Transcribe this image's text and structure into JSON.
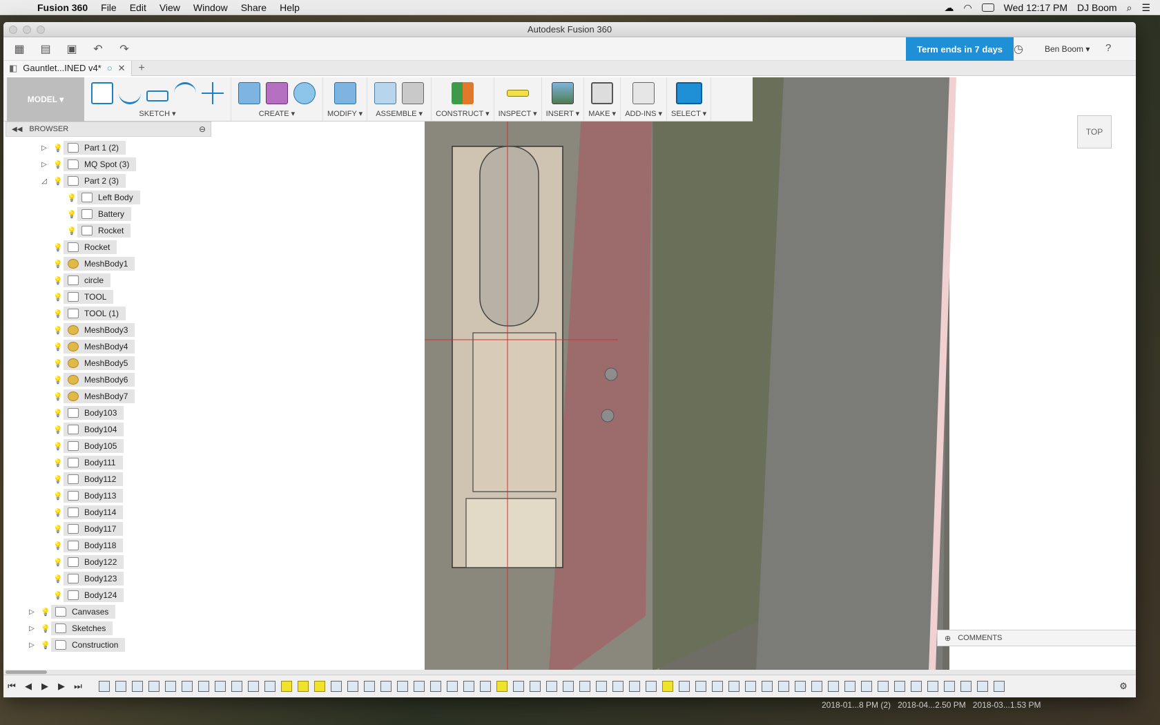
{
  "menubar": {
    "app": "Fusion 360",
    "items": [
      "File",
      "Edit",
      "View",
      "Window",
      "Share",
      "Help"
    ],
    "clock": "Wed 12:17 PM",
    "user": "DJ Boom"
  },
  "window": {
    "title": "Autodesk Fusion 360",
    "term": "Term ends in 7 days",
    "account": "Ben Boom ▾",
    "tab_title": "Gauntlet...INED v4*"
  },
  "ribbon": {
    "workspace": "MODEL ▾",
    "groups": [
      "SKETCH ▾",
      "CREATE ▾",
      "MODIFY ▾",
      "ASSEMBLE ▾",
      "CONSTRUCT ▾",
      "INSPECT ▾",
      "INSERT ▾",
      "MAKE ▾",
      "ADD-INS ▾",
      "SELECT ▾"
    ]
  },
  "browser": {
    "title": "BROWSER",
    "items": [
      {
        "label": "Part 1 (2)",
        "bulb": "on",
        "icon": "folder",
        "expand": "▷"
      },
      {
        "label": "MQ Spot (3)",
        "bulb": "on",
        "icon": "folder",
        "expand": "▷"
      },
      {
        "label": "Part 2 (3)",
        "bulb": "on",
        "icon": "folder",
        "expand": "◿"
      },
      {
        "label": "Left Body",
        "bulb": "on",
        "icon": "body",
        "expand": ""
      },
      {
        "label": "Battery",
        "bulb": "off",
        "icon": "body",
        "expand": ""
      },
      {
        "label": "Rocket",
        "bulb": "on",
        "icon": "body",
        "expand": ""
      },
      {
        "label": "Rocket",
        "bulb": "off",
        "icon": "folder",
        "expand": ""
      },
      {
        "label": "MeshBody1",
        "bulb": "off",
        "icon": "mesh",
        "expand": ""
      },
      {
        "label": "circle",
        "bulb": "off",
        "icon": "body",
        "expand": ""
      },
      {
        "label": "TOOL",
        "bulb": "off",
        "icon": "body",
        "expand": ""
      },
      {
        "label": "TOOL (1)",
        "bulb": "off",
        "icon": "body",
        "expand": ""
      },
      {
        "label": "MeshBody3",
        "bulb": "off",
        "icon": "mesh",
        "expand": ""
      },
      {
        "label": "MeshBody4",
        "bulb": "off",
        "icon": "mesh",
        "expand": ""
      },
      {
        "label": "MeshBody5",
        "bulb": "off",
        "icon": "mesh",
        "expand": ""
      },
      {
        "label": "MeshBody6",
        "bulb": "off",
        "icon": "mesh",
        "expand": ""
      },
      {
        "label": "MeshBody7",
        "bulb": "off",
        "icon": "mesh",
        "expand": ""
      },
      {
        "label": "Body103",
        "bulb": "off",
        "icon": "body",
        "expand": ""
      },
      {
        "label": "Body104",
        "bulb": "off",
        "icon": "body",
        "expand": ""
      },
      {
        "label": "Body105",
        "bulb": "off",
        "icon": "body",
        "expand": ""
      },
      {
        "label": "Body111",
        "bulb": "off",
        "icon": "body",
        "expand": ""
      },
      {
        "label": "Body112",
        "bulb": "on",
        "icon": "body",
        "expand": ""
      },
      {
        "label": "Body113",
        "bulb": "off",
        "icon": "body",
        "expand": ""
      },
      {
        "label": "Body114",
        "bulb": "off",
        "icon": "body",
        "expand": ""
      },
      {
        "label": "Body117",
        "bulb": "on",
        "icon": "body",
        "expand": ""
      },
      {
        "label": "Body118",
        "bulb": "off",
        "icon": "body",
        "expand": ""
      },
      {
        "label": "Body122",
        "bulb": "off",
        "icon": "body",
        "expand": ""
      },
      {
        "label": "Body123",
        "bulb": "off",
        "icon": "body",
        "expand": ""
      },
      {
        "label": "Body124",
        "bulb": "off",
        "icon": "body",
        "expand": ""
      },
      {
        "label": "Canvases",
        "bulb": "on",
        "icon": "folder",
        "expand": "▷"
      },
      {
        "label": "Sketches",
        "bulb": "off",
        "icon": "folder",
        "expand": "▷"
      },
      {
        "label": "Construction",
        "bulb": "on",
        "icon": "folder",
        "expand": "▷"
      }
    ]
  },
  "viewcube": {
    "face": "TOP"
  },
  "comments": {
    "label": "COMMENTS"
  },
  "timeline": {
    "highlighted": [
      11,
      12,
      13,
      24,
      34
    ]
  },
  "dock": [
    "2018-01...8 PM (2)",
    "2018-04...2.50 PM",
    "2018-03...1.53 PM"
  ],
  "colors": {
    "accent": "#1f8fd6",
    "bulb_on": "#e8c534",
    "bulb_off": "#7a9fc8"
  }
}
